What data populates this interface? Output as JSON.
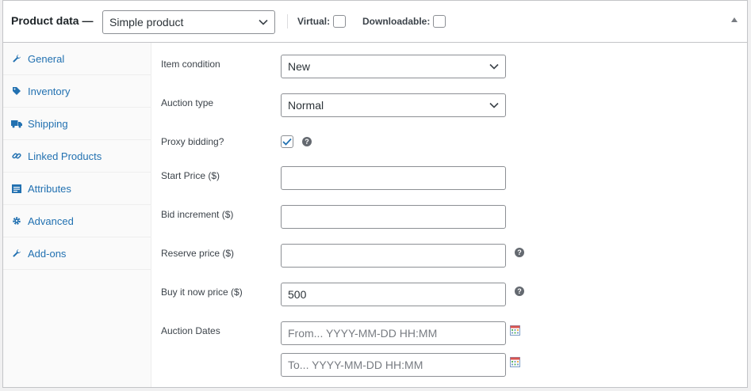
{
  "header": {
    "title": "Product data —",
    "product_type": "Simple product",
    "virtual_label": "Virtual:",
    "downloadable_label": "Downloadable:"
  },
  "tabs": [
    {
      "label": "General",
      "icon": "wrench-icon"
    },
    {
      "label": "Inventory",
      "icon": "tag-icon"
    },
    {
      "label": "Shipping",
      "icon": "truck-icon"
    },
    {
      "label": "Linked Products",
      "icon": "link-icon"
    },
    {
      "label": "Attributes",
      "icon": "list-icon"
    },
    {
      "label": "Advanced",
      "icon": "gear-icon"
    },
    {
      "label": "Add-ons",
      "icon": "wrench-icon"
    }
  ],
  "fields": {
    "item_condition": {
      "label": "Item condition",
      "value": "New"
    },
    "auction_type": {
      "label": "Auction type",
      "value": "Normal"
    },
    "proxy_bidding": {
      "label": "Proxy bidding?",
      "checked": true
    },
    "start_price": {
      "label": "Start Price ($)",
      "value": ""
    },
    "bid_increment": {
      "label": "Bid increment ($)",
      "value": ""
    },
    "reserve_price": {
      "label": "Reserve price ($)",
      "value": ""
    },
    "buy_now_price": {
      "label": "Buy it now price ($)",
      "value": "500"
    },
    "auction_dates": {
      "label": "Auction Dates",
      "from_placeholder": "From... YYYY-MM-DD HH:MM",
      "to_placeholder": "To... YYYY-MM-DD HH:MM"
    }
  },
  "help_glyph": "?",
  "colors": {
    "accent": "#2271b1",
    "border": "#8c8f94",
    "check": "#2271b1"
  }
}
